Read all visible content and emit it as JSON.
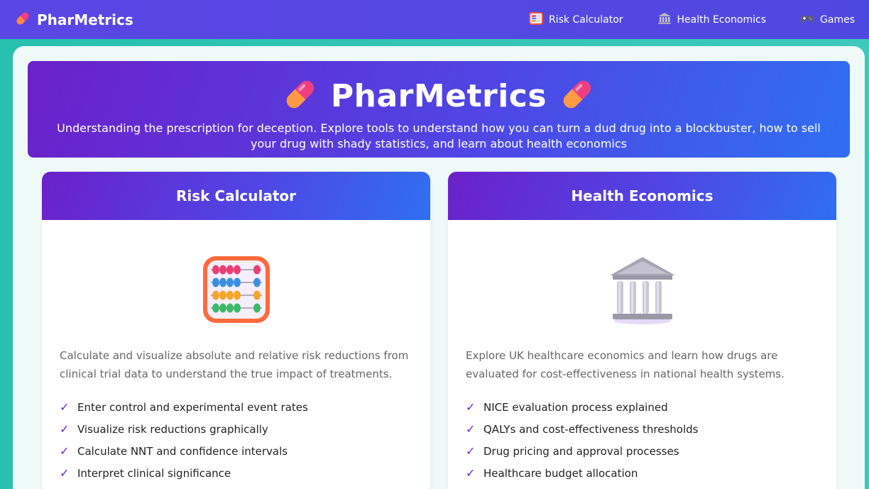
{
  "nav": {
    "brand": "PharMetrics",
    "links": [
      {
        "label": "Risk Calculator",
        "icon": "abacus-icon"
      },
      {
        "label": "Health Economics",
        "icon": "bank-icon"
      },
      {
        "label": "Games",
        "icon": "gamepad-icon"
      }
    ]
  },
  "hero": {
    "title": "PharMetrics",
    "subtitle": "Understanding the prescription for deception. Explore tools to understand how you can turn a dud drug into a blockbuster, how to sell your drug with shady statistics, and learn about health economics"
  },
  "cards": [
    {
      "title": "Risk Calculator",
      "icon": "abacus-icon",
      "description": "Calculate and visualize absolute and relative risk reductions from clinical trial data to understand the true impact of treatments.",
      "features": [
        "Enter control and experimental event rates",
        "Visualize risk reductions graphically",
        "Calculate NNT and confidence intervals",
        "Interpret clinical significance"
      ]
    },
    {
      "title": "Health Economics",
      "icon": "bank-icon",
      "description": "Explore UK healthcare economics and learn how drugs are evaluated for cost-effectiveness in national health systems.",
      "features": [
        "NICE evaluation process explained",
        "QALYs and cost-effectiveness thresholds",
        "Drug pricing and approval processes",
        "Healthcare budget allocation"
      ]
    }
  ],
  "colors": {
    "accent": "#6b21c9",
    "navbar": "#5a46e4",
    "background": "#27c0ae"
  }
}
